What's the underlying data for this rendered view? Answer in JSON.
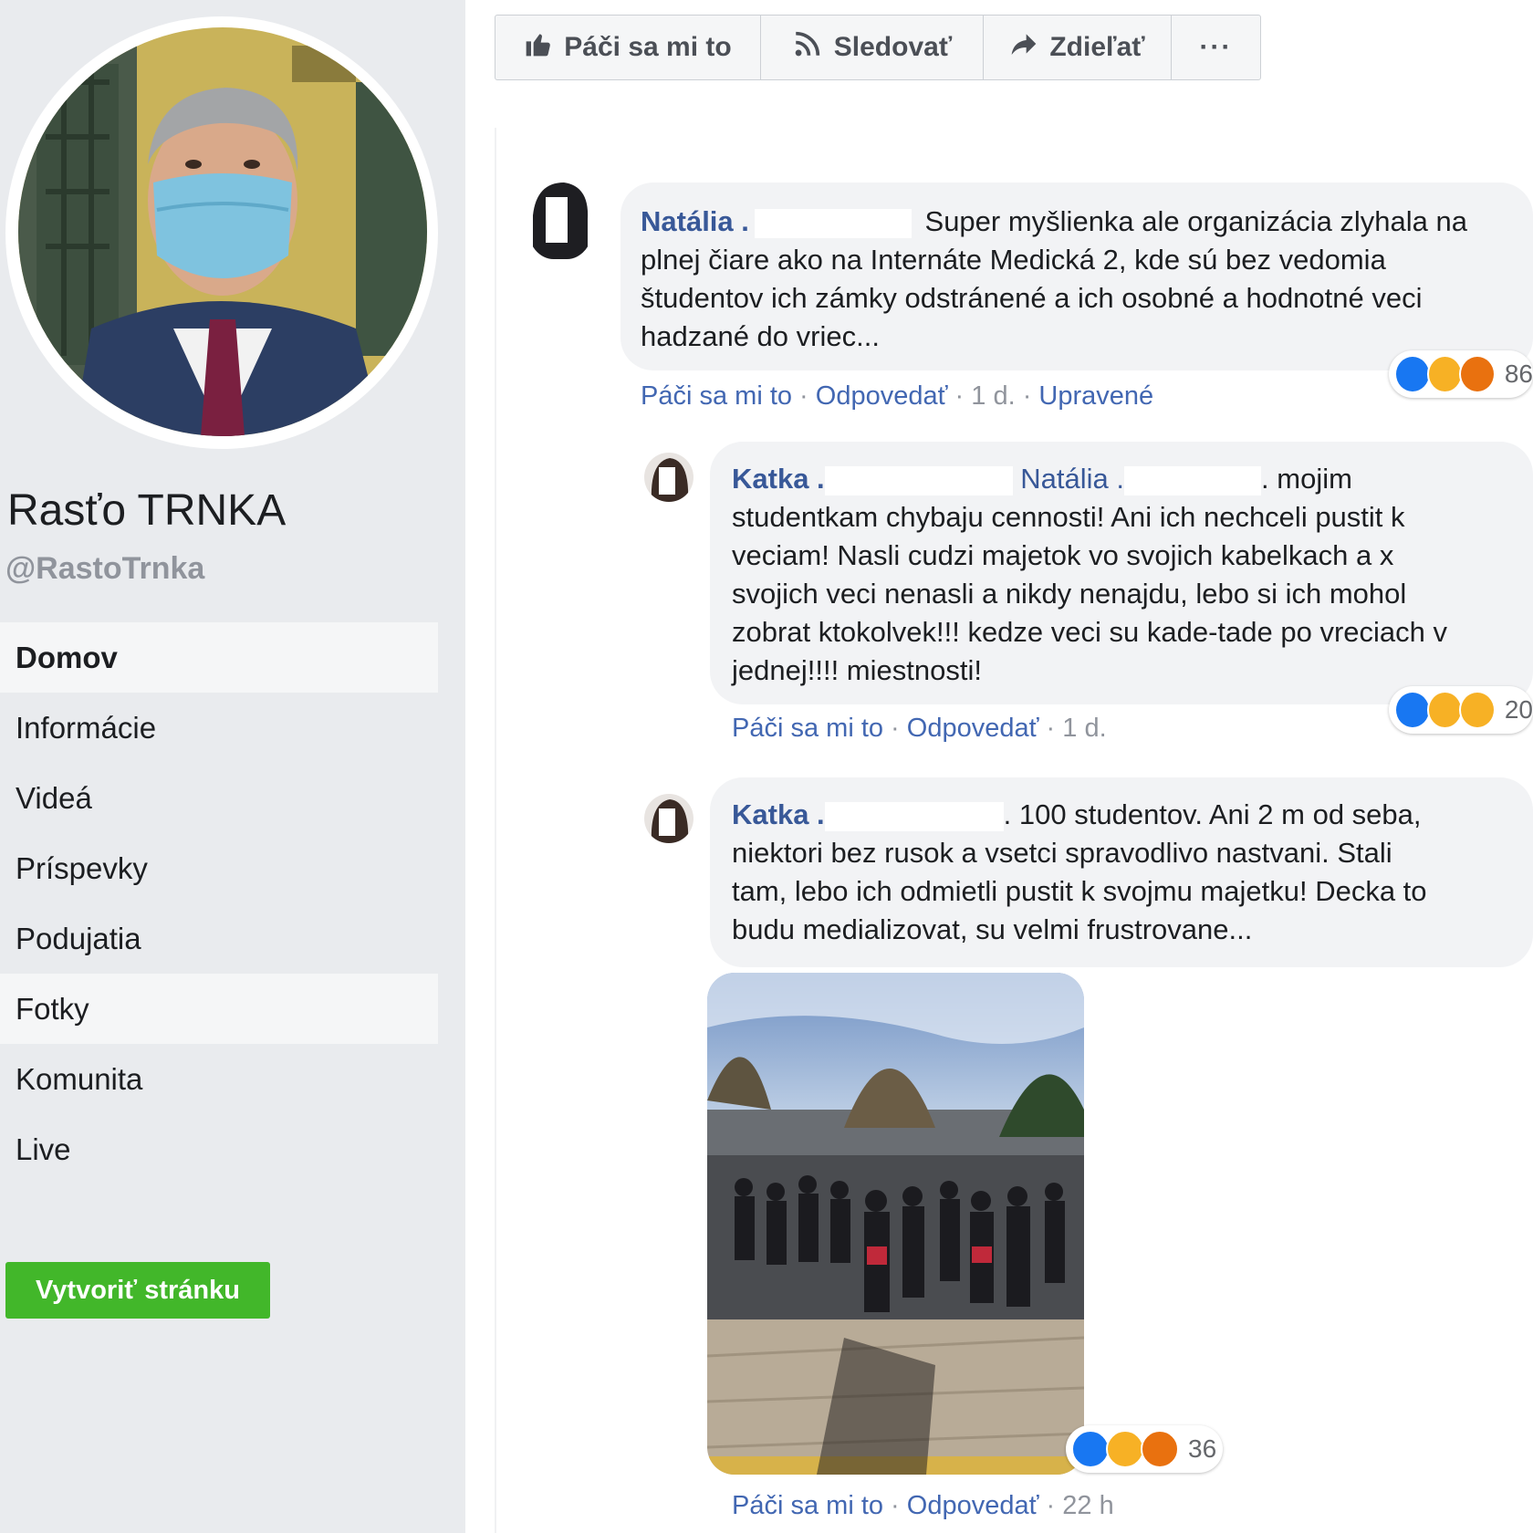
{
  "page": {
    "name": "Rasťo TRNKA",
    "handle": "@RastoTrnka"
  },
  "sidebar": {
    "items": [
      {
        "label": "Domov"
      },
      {
        "label": "Informácie"
      },
      {
        "label": "Videá"
      },
      {
        "label": "Príspevky"
      },
      {
        "label": "Podujatia"
      },
      {
        "label": "Fotky"
      },
      {
        "label": "Komunita"
      },
      {
        "label": "Live"
      }
    ],
    "create_page_label": "Vytvoriť stránku"
  },
  "actions": {
    "like": "Páči sa mi to",
    "follow": "Sledovať",
    "share": "Zdieľať",
    "more": "···"
  },
  "comments": [
    {
      "author": "Natália .",
      "line1": "Super myšlienka ale organizácia zlyhala na",
      "line2": "plnej čiare ako na Internáte Medická 2, kde sú bez vedomia",
      "line3": "študentov ich zámky odstránené a ich osobné a hodnotné veci",
      "line4": "hadzané do vriec...",
      "like": "Páči sa mi to",
      "reply": "Odpovedať",
      "time": "1 d.",
      "edited": "Upravené",
      "reaction_count": "86"
    },
    {
      "author": "Katka .",
      "mention": "Natália .",
      "line1_tail": ". mojim",
      "line2": "studentkam chybaju cennosti! Ani ich nechceli pustit k",
      "line3": "veciam! Nasli cudzi majetok vo svojich kabelkach a x",
      "line4": "svojich veci nenasli a nikdy nenajdu, lebo si ich mohol",
      "line5": "zobrat ktokolvek!!! kedze veci su kade-tade po vreciach v",
      "line6": "jednej!!!! miestnosti!",
      "like": "Páči sa mi to",
      "reply": "Odpovedať",
      "time": "1 d.",
      "reaction_count": "20"
    },
    {
      "author": "Katka .",
      "line1": ". 100 studentov. Ani 2 m od seba,",
      "line2": "niektori bez rusok a vsetci spravodlivo nastvani. Stali",
      "line3": "tam, lebo ich odmietli pustit k svojmu majetku! Decka to",
      "line4": "budu medializovat, su velmi frustrovane...",
      "like": "Páči sa mi to",
      "reply": "Odpovedať",
      "time": "22 h",
      "reaction_count": "36"
    }
  ],
  "icons": {
    "like": "thumbs-up-icon",
    "follow": "rss-icon",
    "share": "share-arrow-icon",
    "more": "ellipsis-icon"
  },
  "colors": {
    "link": "#385898",
    "create_button": "#42b72a",
    "sidebar_bg": "#e9ebee"
  }
}
